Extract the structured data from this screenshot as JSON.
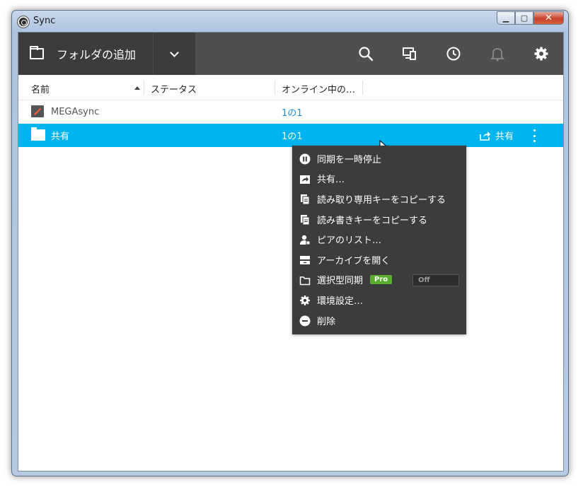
{
  "window": {
    "title": "Sync"
  },
  "toolbar": {
    "add_folder_label": "フォルダの追加",
    "icons": [
      "search-icon",
      "devices-icon",
      "history-icon",
      "bell-icon",
      "gear-icon"
    ]
  },
  "columns": {
    "name": "名前",
    "status": "ステータス",
    "online": "オンライン中の…"
  },
  "rows": [
    {
      "name": "MEGAsync",
      "status": "",
      "online": "1の1"
    },
    {
      "name": "共有",
      "status": "",
      "online": "1の1",
      "share_label": "共有"
    }
  ],
  "menu": {
    "items": [
      {
        "label": "同期を一時停止",
        "icon": "pause-icon"
      },
      {
        "label": "共有…",
        "icon": "share-icon"
      },
      {
        "label": "読み取り専用キーをコピーする",
        "icon": "copy-icon"
      },
      {
        "label": "読み書きキーをコピーする",
        "icon": "copy-icon"
      },
      {
        "label": "ピアのリスト…",
        "icon": "peers-icon"
      },
      {
        "label": "アーカイブを開く",
        "icon": "archive-icon"
      },
      {
        "label": "選択型同期",
        "icon": "folder-icon",
        "badge": "Pro",
        "toggle": "Off"
      },
      {
        "label": "環境設定…",
        "icon": "gear-icon"
      },
      {
        "label": "削除",
        "icon": "remove-icon"
      }
    ]
  },
  "colors": {
    "toolbar": "#4f4f4f",
    "selection": "#00b4f0",
    "link": "#1e8fd5",
    "pro_badge": "#5aac2f"
  }
}
